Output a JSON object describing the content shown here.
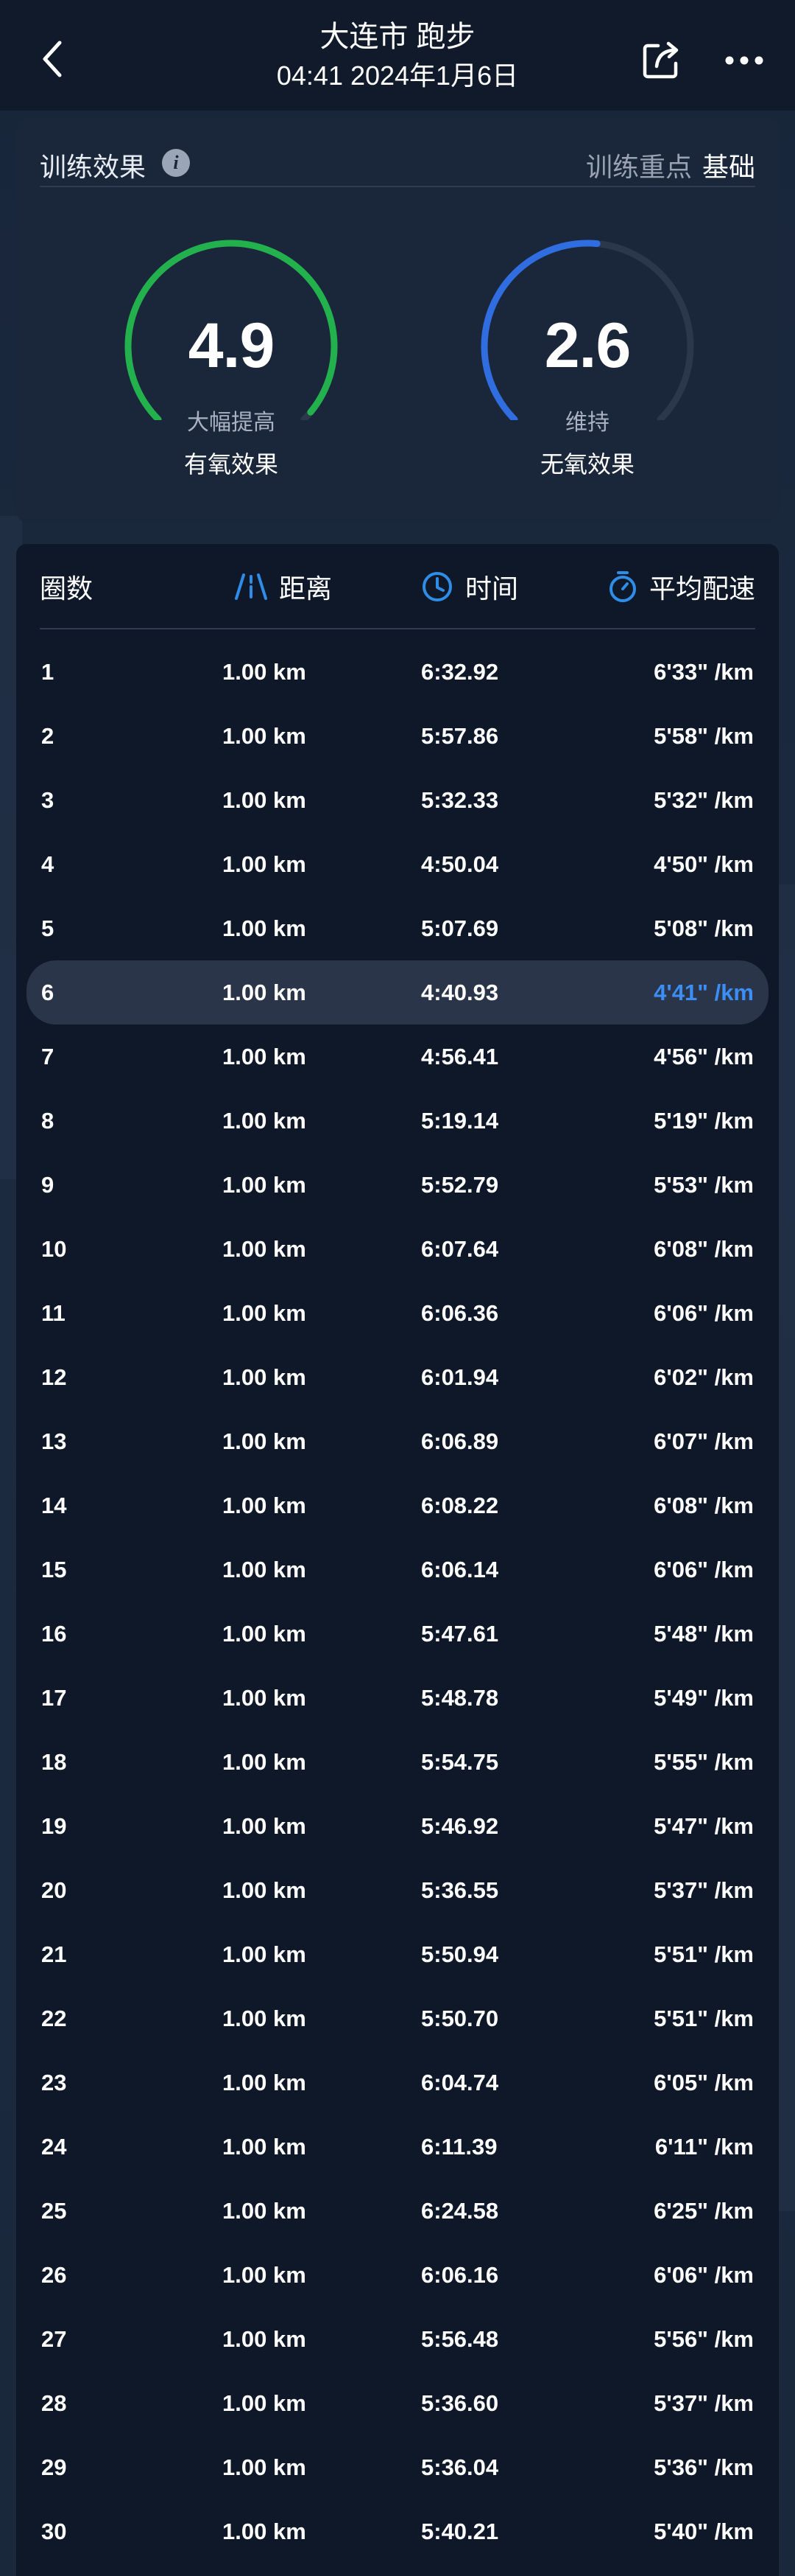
{
  "header": {
    "title": "大连市 跑步",
    "subtitle": "04:41 2024年1月6日"
  },
  "colors": {
    "aerobic_arc": "#22b14c",
    "anaerobic_arc": "#2f6de0",
    "highlight_pace": "#3c8ef5",
    "icon_blue": "#2f8de8"
  },
  "effect": {
    "title": "训练效果",
    "focus_label": "训练重点",
    "focus_value": "基础",
    "aerobic": {
      "value": "4.9",
      "level": "大幅提高",
      "name": "有氧效果",
      "fraction": 0.98
    },
    "anaerobic": {
      "value": "2.6",
      "level": "维持",
      "name": "无氧效果",
      "fraction": 0.52
    }
  },
  "laps": {
    "headers": {
      "lap": "圈数",
      "distance": "距离",
      "time": "时间",
      "pace": "平均配速"
    },
    "highlight_index": 5,
    "rows": [
      {
        "lap": "1",
        "distance": "1.00 km",
        "time": "6:32.92",
        "pace": "6'33\" /km"
      },
      {
        "lap": "2",
        "distance": "1.00 km",
        "time": "5:57.86",
        "pace": "5'58\" /km"
      },
      {
        "lap": "3",
        "distance": "1.00 km",
        "time": "5:32.33",
        "pace": "5'32\" /km"
      },
      {
        "lap": "4",
        "distance": "1.00 km",
        "time": "4:50.04",
        "pace": "4'50\" /km"
      },
      {
        "lap": "5",
        "distance": "1.00 km",
        "time": "5:07.69",
        "pace": "5'08\" /km"
      },
      {
        "lap": "6",
        "distance": "1.00 km",
        "time": "4:40.93",
        "pace": "4'41\" /km"
      },
      {
        "lap": "7",
        "distance": "1.00 km",
        "time": "4:56.41",
        "pace": "4'56\" /km"
      },
      {
        "lap": "8",
        "distance": "1.00 km",
        "time": "5:19.14",
        "pace": "5'19\" /km"
      },
      {
        "lap": "9",
        "distance": "1.00 km",
        "time": "5:52.79",
        "pace": "5'53\" /km"
      },
      {
        "lap": "10",
        "distance": "1.00 km",
        "time": "6:07.64",
        "pace": "6'08\" /km"
      },
      {
        "lap": "11",
        "distance": "1.00 km",
        "time": "6:06.36",
        "pace": "6'06\" /km"
      },
      {
        "lap": "12",
        "distance": "1.00 km",
        "time": "6:01.94",
        "pace": "6'02\" /km"
      },
      {
        "lap": "13",
        "distance": "1.00 km",
        "time": "6:06.89",
        "pace": "6'07\" /km"
      },
      {
        "lap": "14",
        "distance": "1.00 km",
        "time": "6:08.22",
        "pace": "6'08\" /km"
      },
      {
        "lap": "15",
        "distance": "1.00 km",
        "time": "6:06.14",
        "pace": "6'06\" /km"
      },
      {
        "lap": "16",
        "distance": "1.00 km",
        "time": "5:47.61",
        "pace": "5'48\" /km"
      },
      {
        "lap": "17",
        "distance": "1.00 km",
        "time": "5:48.78",
        "pace": "5'49\" /km"
      },
      {
        "lap": "18",
        "distance": "1.00 km",
        "time": "5:54.75",
        "pace": "5'55\" /km"
      },
      {
        "lap": "19",
        "distance": "1.00 km",
        "time": "5:46.92",
        "pace": "5'47\" /km"
      },
      {
        "lap": "20",
        "distance": "1.00 km",
        "time": "5:36.55",
        "pace": "5'37\" /km"
      },
      {
        "lap": "21",
        "distance": "1.00 km",
        "time": "5:50.94",
        "pace": "5'51\" /km"
      },
      {
        "lap": "22",
        "distance": "1.00 km",
        "time": "5:50.70",
        "pace": "5'51\" /km"
      },
      {
        "lap": "23",
        "distance": "1.00 km",
        "time": "6:04.74",
        "pace": "6'05\" /km"
      },
      {
        "lap": "24",
        "distance": "1.00 km",
        "time": "6:11.39",
        "pace": "6'11\" /km"
      },
      {
        "lap": "25",
        "distance": "1.00 km",
        "time": "6:24.58",
        "pace": "6'25\" /km"
      },
      {
        "lap": "26",
        "distance": "1.00 km",
        "time": "6:06.16",
        "pace": "6'06\" /km"
      },
      {
        "lap": "27",
        "distance": "1.00 km",
        "time": "5:56.48",
        "pace": "5'56\" /km"
      },
      {
        "lap": "28",
        "distance": "1.00 km",
        "time": "5:36.60",
        "pace": "5'37\" /km"
      },
      {
        "lap": "29",
        "distance": "1.00 km",
        "time": "5:36.04",
        "pace": "5'36\" /km"
      },
      {
        "lap": "30",
        "distance": "1.00 km",
        "time": "5:40.21",
        "pace": "5'40\" /km"
      }
    ]
  }
}
